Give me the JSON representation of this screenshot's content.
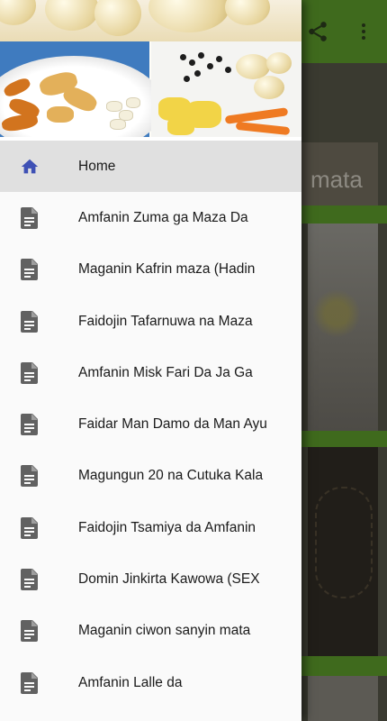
{
  "background": {
    "card_overlay_text": "mata",
    "toolbar_color": "#3f6a1d"
  },
  "drawer": {
    "header_image": "spices-header-image",
    "menu": [
      {
        "label": "Home",
        "icon": "home-icon",
        "active": true
      },
      {
        "label": "Amfanin Zuma ga Maza Da",
        "icon": "document-icon",
        "active": false
      },
      {
        "label": "Maganin Kafrin maza (Hadin",
        "icon": "document-icon",
        "active": false
      },
      {
        "label": "Faidojin Tafarnuwa na Maza",
        "icon": "document-icon",
        "active": false
      },
      {
        "label": "Amfanin Misk Fari Da Ja Ga",
        "icon": "document-icon",
        "active": false
      },
      {
        "label": "Faidar Man Damo da Man Ayu",
        "icon": "document-icon",
        "active": false
      },
      {
        "label": "Magungun 20 na Cutuka Kala",
        "icon": "document-icon",
        "active": false
      },
      {
        "label": "Faidojin Tsamiya da Amfanin",
        "icon": "document-icon",
        "active": false
      },
      {
        "label": "Domin Jinkirta Kawowa (SEX",
        "icon": "document-icon",
        "active": false
      },
      {
        "label": "Maganin ciwon sanyin mata",
        "icon": "document-icon",
        "active": false
      },
      {
        "label": "Amfanin Lalle da",
        "icon": "document-icon",
        "active": false
      }
    ],
    "colors": {
      "active_bg": "#e0e0e0",
      "home_icon": "#3f51b5",
      "doc_icon": "#616161"
    }
  }
}
